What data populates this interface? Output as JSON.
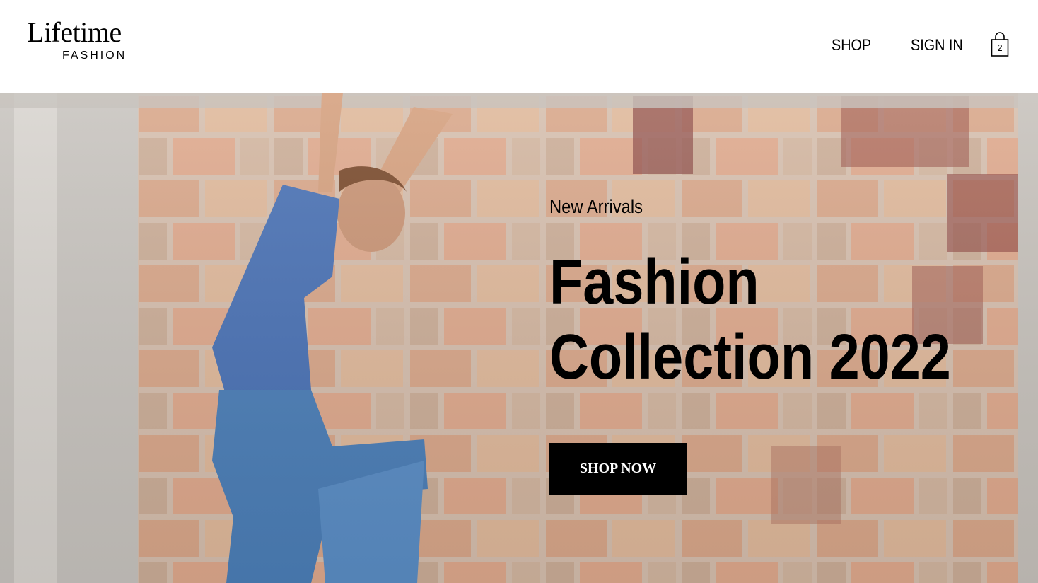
{
  "header": {
    "logo": {
      "title": "Lifetime",
      "subtitle": "FASHION"
    },
    "nav": {
      "shop_label": "SHOP",
      "signin_label": "SIGN IN"
    },
    "cart": {
      "count": "2",
      "icon": "shopping-bag-icon"
    }
  },
  "hero": {
    "eyebrow": "New Arrivals",
    "title_line1": "Fashion",
    "title_line2": "Collection 2022",
    "cta_label": "SHOP NOW",
    "image": "photo-man-jumping-against-brick-wall"
  },
  "colors": {
    "header_bg": "#ffffff",
    "text": "#000000",
    "button_bg": "#000000",
    "button_text": "#ffffff"
  }
}
